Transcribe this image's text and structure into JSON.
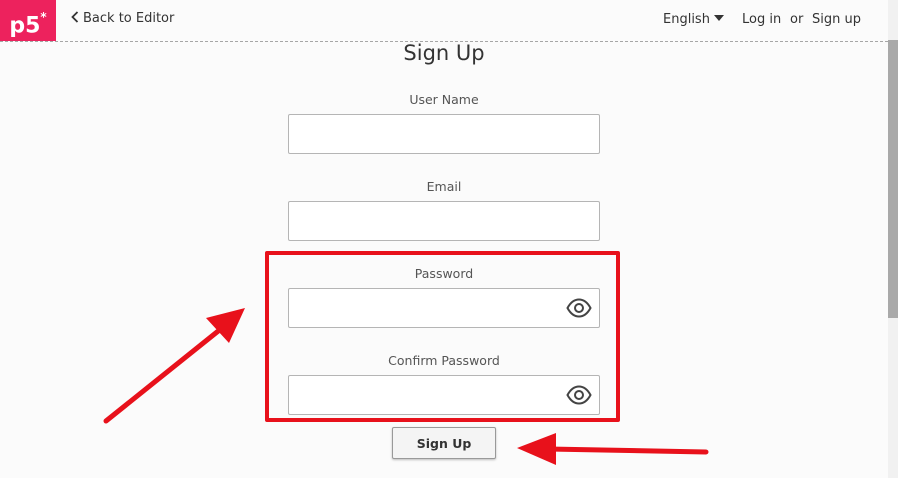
{
  "nav": {
    "logo": "p5",
    "logo_mark": "*",
    "back_label": "Back to Editor",
    "language": "English",
    "login_label": "Log in",
    "or_text": "or",
    "signup_label": "Sign up"
  },
  "form": {
    "title": "Sign Up",
    "username_label": "User Name",
    "username_value": "",
    "email_label": "Email",
    "email_value": "",
    "password_label": "Password",
    "password_value": "",
    "confirm_label": "Confirm Password",
    "confirm_value": "",
    "submit_label": "Sign Up"
  },
  "icons": {
    "back": "chevron-left-icon",
    "language": "caret-down-icon",
    "password_toggle": "eye-icon"
  },
  "colors": {
    "brand": "#ed225d",
    "annotation": "#e8111b"
  }
}
